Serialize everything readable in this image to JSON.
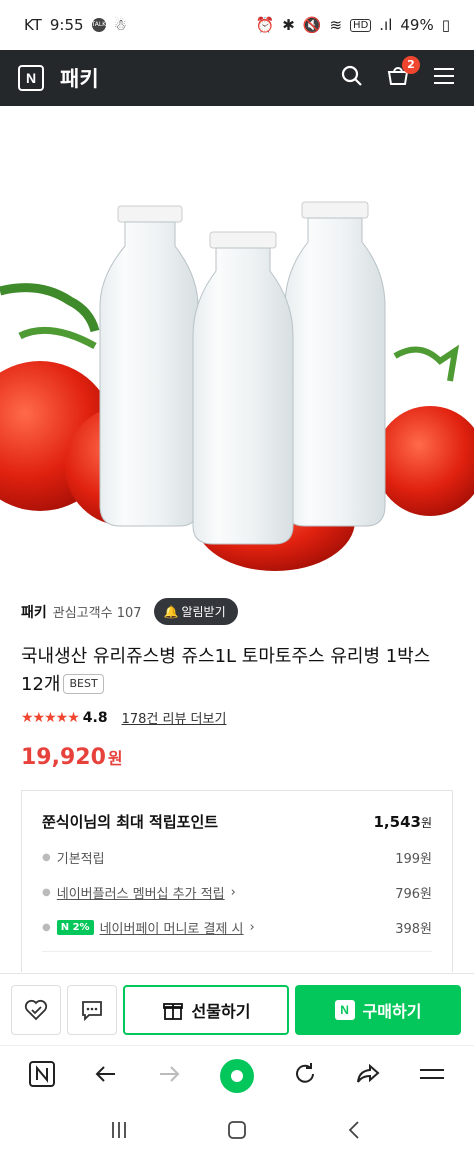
{
  "status": {
    "carrier": "KT",
    "time": "9:55",
    "battery": "49%"
  },
  "header": {
    "store": "패키",
    "cart_count": "2"
  },
  "seller": {
    "name": "패키",
    "fans": "관심고객수 107",
    "alarm": "알림받기"
  },
  "product": {
    "title": "국내생산 유리쥬스병 쥬스1L 토마토주스 유리병 1박스12개",
    "badge": "BEST",
    "stars": "★★★★★",
    "rating": "4.8",
    "reviews": "178건 리뷰 더보기",
    "price": "19,920",
    "currency": "원"
  },
  "points": {
    "title": "쭌식이님의 최대 적립포인트",
    "total": "1,543",
    "unit": "원",
    "rows": [
      {
        "label": "기본적립",
        "value": "199원"
      },
      {
        "label": "네이버플러스 멤버십 추가 적립",
        "value": "796원"
      },
      {
        "badge": "N 2%",
        "label": "네이버페이 머니로 결제 시",
        "value": "398원"
      }
    ]
  },
  "actions": {
    "gift": "선물하기",
    "buy": "구매하기"
  },
  "colors": {
    "accent": "#03c75a",
    "price": "#e7413c",
    "header_bg": "#25282b"
  }
}
